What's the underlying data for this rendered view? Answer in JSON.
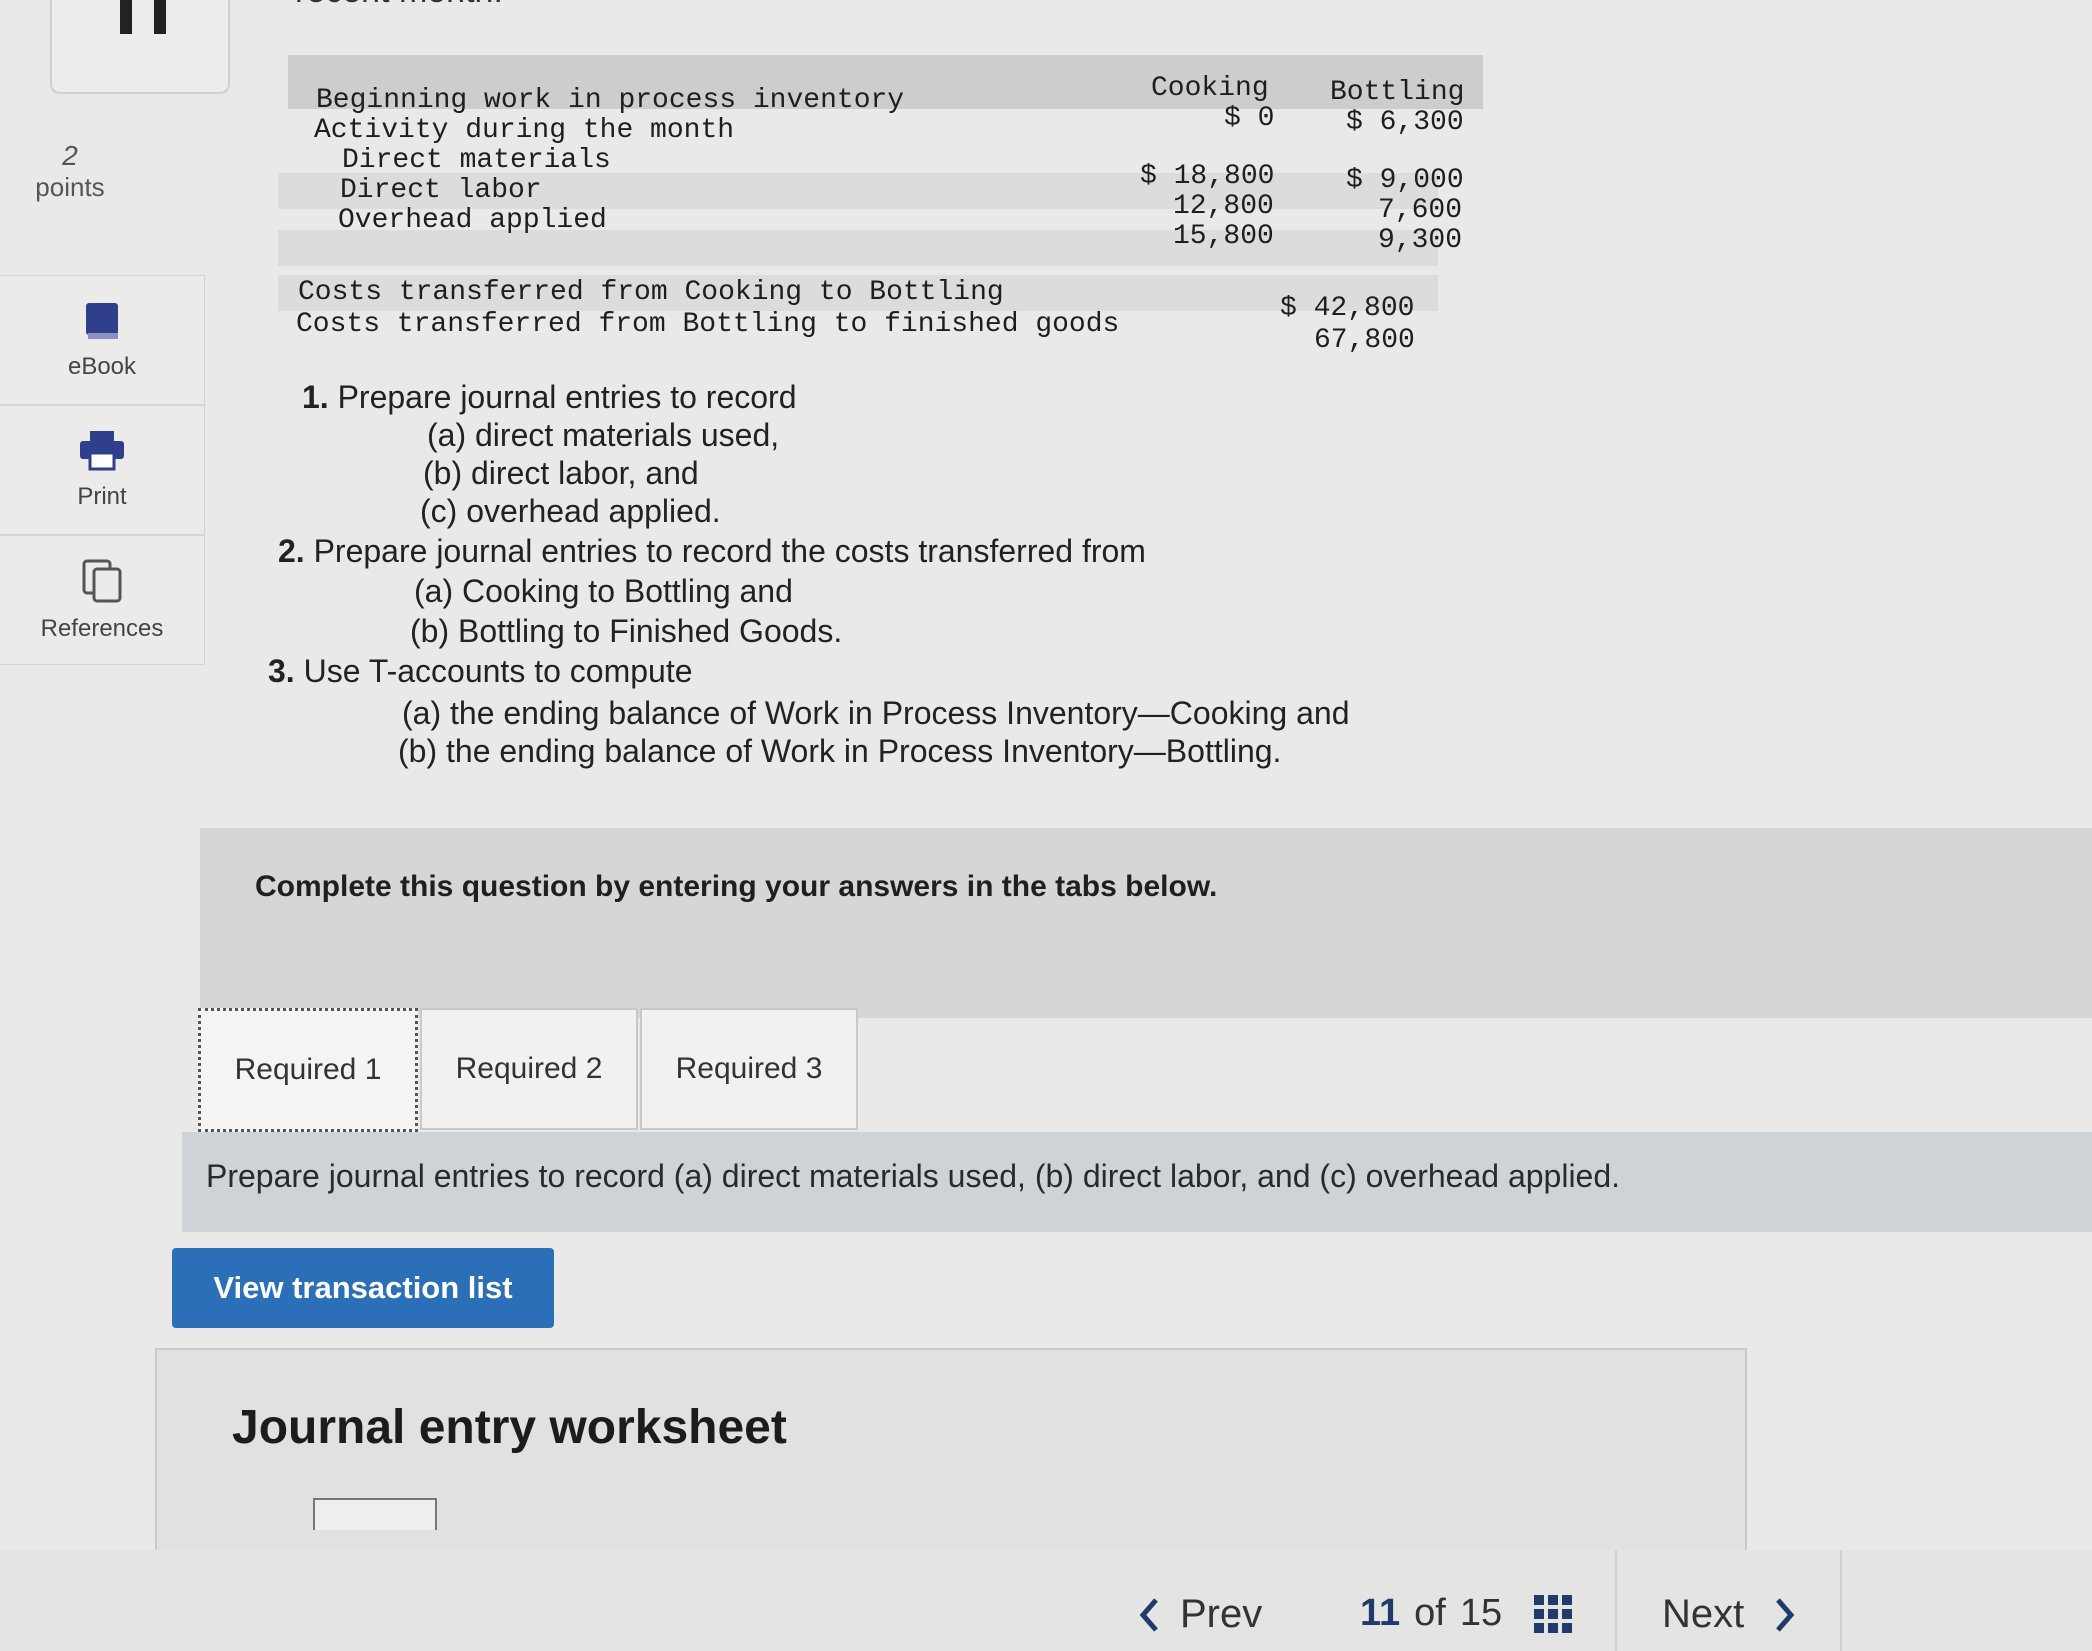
{
  "header": {
    "clipped_text": "recent month."
  },
  "question": {
    "points_value": "2",
    "points_label": "points"
  },
  "sidebar": {
    "items": [
      {
        "label": "eBook",
        "icon": "book-icon"
      },
      {
        "label": "Print",
        "icon": "printer-icon"
      },
      {
        "label": "References",
        "icon": "copy-icon"
      }
    ]
  },
  "table": {
    "col_cooking": "Cooking",
    "col_bottling": "Bottling",
    "rows": [
      {
        "label": "Beginning work in process inventory",
        "cooking": "$ 0",
        "bottling": "$ 6,300"
      },
      {
        "label": "Activity during the month",
        "cooking": "",
        "bottling": ""
      },
      {
        "label": "Direct materials",
        "cooking": "$ 18,800",
        "bottling": "$ 9,000"
      },
      {
        "label": "Direct labor",
        "cooking": "12,800",
        "bottling": "7,600"
      },
      {
        "label": "Overhead applied",
        "cooking": "15,800",
        "bottling": "9,300"
      }
    ],
    "transfers": [
      {
        "label": "Costs transferred from Cooking to Bottling",
        "value": "$ 42,800"
      },
      {
        "label": "Costs transferred from Bottling to finished goods",
        "value": "67,800"
      }
    ]
  },
  "instructions": {
    "i1_num": "1.",
    "i1": "Prepare journal entries to record",
    "i1a": "(a) direct materials used,",
    "i1b": "(b) direct labor, and",
    "i1c": "(c) overhead applied.",
    "i2_num": "2.",
    "i2": "Prepare journal entries to record the costs transferred from",
    "i2a": "(a) Cooking to Bottling and",
    "i2b": "(b) Bottling to Finished Goods.",
    "i3_num": "3.",
    "i3": "Use T-accounts to compute",
    "i3a": "(a) the ending balance of Work in Process Inventory—Cooking and",
    "i3b": "(b) the ending balance of Work in Process Inventory—Bottling."
  },
  "complete_text": "Complete this question by entering your answers in the tabs below.",
  "tabs": [
    "Required 1",
    "Required 2",
    "Required 3"
  ],
  "active_tab": "Required 1",
  "prompt": "Prepare journal entries to record (a) direct materials used, (b) direct labor, and (c) overhead applied.",
  "view_button": "View transaction list",
  "worksheet_title": "Journal entry worksheet",
  "footer": {
    "prev": "Prev",
    "current": "11",
    "of": "of",
    "total": "15",
    "next": "Next"
  },
  "colors": {
    "button_blue": "#2a6fb8",
    "pager_blue": "#1f3a6b"
  }
}
